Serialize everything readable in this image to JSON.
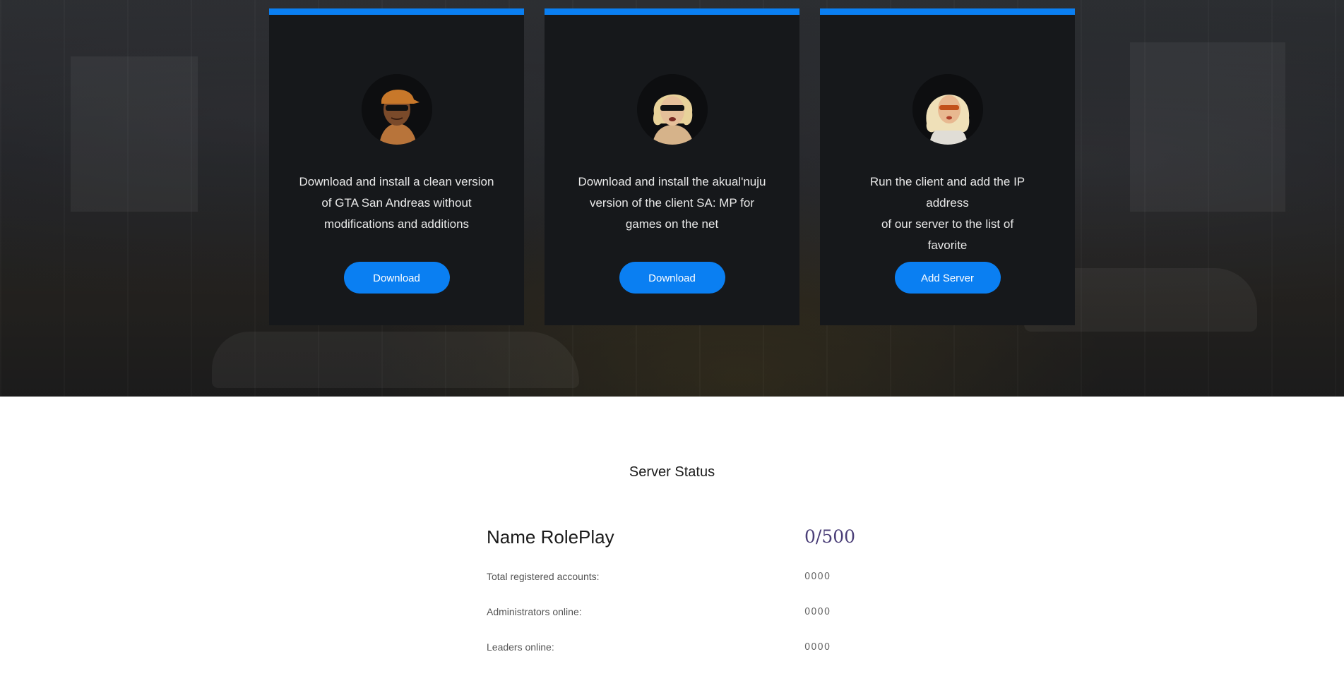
{
  "cards": [
    {
      "avatar_icon": "cj-character-avatar",
      "text_lines": [
        "Download and install a clean version",
        "of GTA San Andreas without",
        "modifications and additions"
      ],
      "button": "Download"
    },
    {
      "avatar_icon": "blonde-sunglasses-character-avatar",
      "text_lines": [
        "Download and install the akual'nuju",
        "version of the client SA: MP for",
        "games on the net"
      ],
      "button": "Download"
    },
    {
      "avatar_icon": "blonde-woman-character-avatar",
      "text_lines": [
        "Run the client and add the IP address",
        "of our server to the list of",
        "favorite"
      ],
      "button": "Add Server"
    }
  ],
  "status": {
    "title": "Server Status",
    "server_name": "Name RolePlay",
    "online": "0/500",
    "rows": [
      {
        "label": "Total registered accounts:",
        "value": "0000"
      },
      {
        "label": "Administrators online:",
        "value": "0000"
      },
      {
        "label": "Leaders online:",
        "value": "0000"
      }
    ]
  },
  "colors": {
    "accent": "#0a7ff2",
    "card_bg": "#16181b",
    "online_count": "#4b3f78"
  }
}
